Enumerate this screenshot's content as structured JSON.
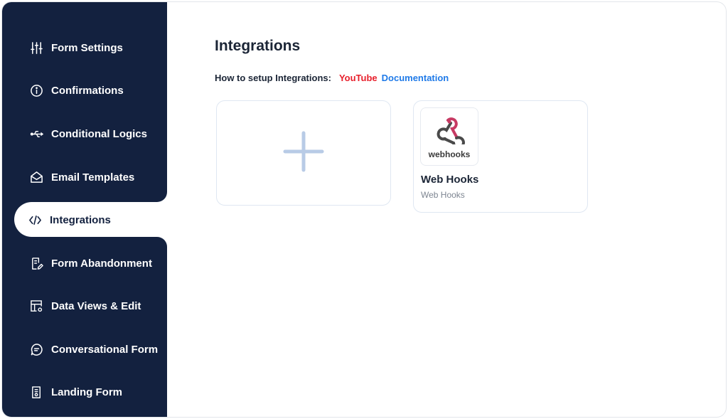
{
  "sidebar": {
    "items": [
      {
        "label": "Form Settings",
        "icon": "sliders-icon"
      },
      {
        "label": "Confirmations",
        "icon": "info-icon"
      },
      {
        "label": "Conditional Logics",
        "icon": "usb-icon"
      },
      {
        "label": "Email Templates",
        "icon": "envelope-open-icon"
      },
      {
        "label": "Integrations",
        "icon": "code-icon",
        "active": true
      },
      {
        "label": "Form Abandonment",
        "icon": "document-edit-icon"
      },
      {
        "label": "Data Views & Edit",
        "icon": "table-gear-icon"
      },
      {
        "label": "Conversational Form",
        "icon": "chat-icon"
      },
      {
        "label": "Landing Form",
        "icon": "document-list-icon"
      }
    ],
    "colors": {
      "background": "#13213f",
      "text": "#ffffff"
    }
  },
  "main": {
    "title": "Integrations",
    "howto_label": "How to setup Integrations:",
    "youtube_label": "YouTube",
    "documentation_label": "Documentation",
    "colors": {
      "youtube": "#e8202c",
      "documentation": "#1f7ae8"
    },
    "add_card": {
      "icon": "plus-icon"
    },
    "integrations": [
      {
        "logo_text": "webhooks",
        "title": "Web Hooks",
        "subtitle": "Web Hooks",
        "icon": "webhooks-logo-icon"
      }
    ]
  }
}
